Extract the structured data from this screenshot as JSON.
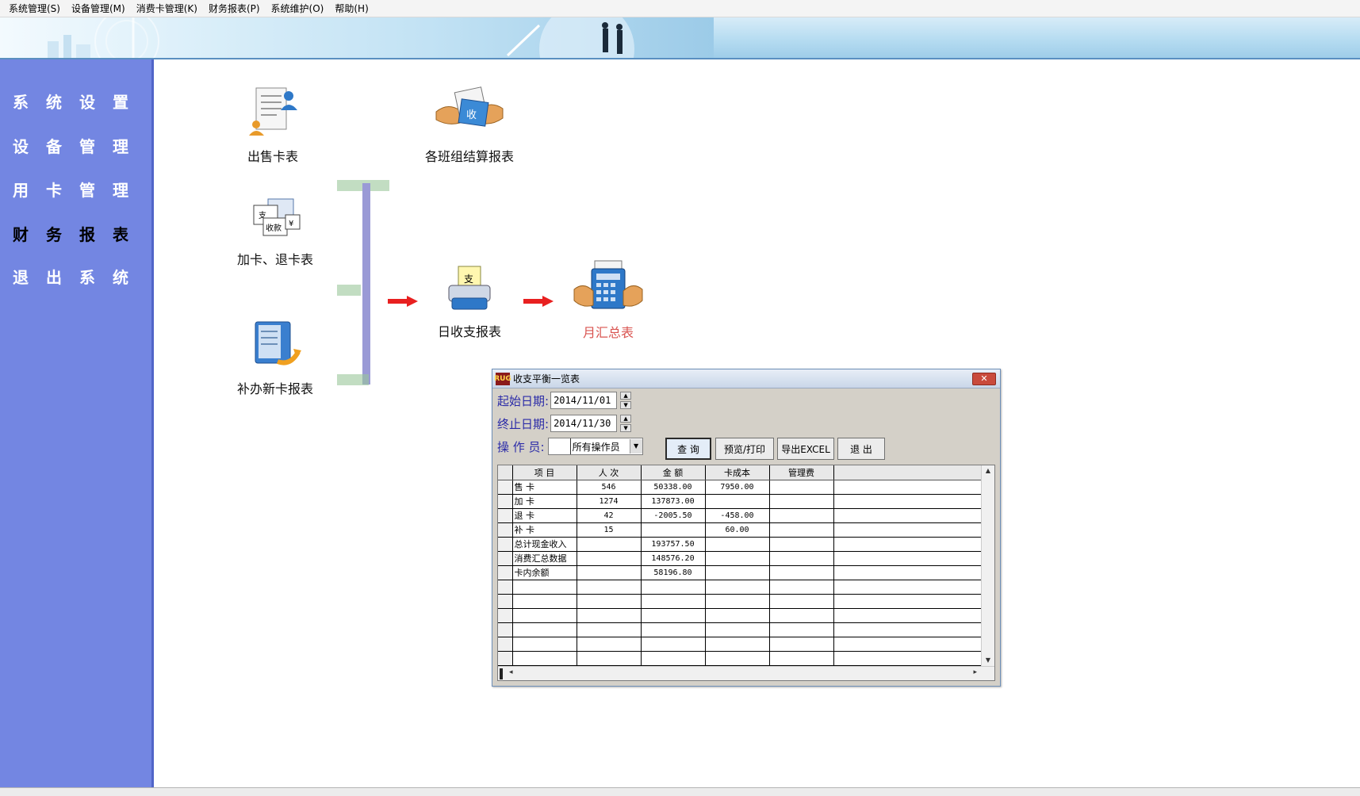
{
  "menubar": {
    "items": [
      "系统管理(S)",
      "设备管理(M)",
      "消费卡管理(K)",
      "财务报表(P)",
      "系统维护(O)",
      "帮助(H)"
    ]
  },
  "sidebar": {
    "items": [
      {
        "label": "系统设置",
        "active": false
      },
      {
        "label": "设备管理",
        "active": false
      },
      {
        "label": "用卡管理",
        "active": false
      },
      {
        "label": "财务报表",
        "active": true
      },
      {
        "label": "退出系统",
        "active": false
      }
    ]
  },
  "reports": {
    "sell_card": "出售卡表",
    "add_return_card": "加卡、退卡表",
    "reissue_card": "补办新卡报表",
    "shift_settlement": "各班组结算报表",
    "daily_income": "日收支报表",
    "monthly_summary": "月汇总表"
  },
  "icons": {
    "sell_card": "document-person-icon",
    "add_return_card": "receipt-cash-icon",
    "reissue_card": "card-reissue-icon",
    "shift_settlement": "handshake-receipt-icon",
    "daily_income": "printer-receipt-icon",
    "monthly_summary": "calculator-hands-icon",
    "arrow": "red-arrow-right-icon",
    "close": "close-icon"
  },
  "colors": {
    "sidebar_bg": "#7386e2",
    "connector": "#9a9ad6",
    "arrow": "#e82020",
    "form_label": "#2b2ba8",
    "monthly_label": "#d9534f"
  },
  "dialog": {
    "title": "收支平衡一览表",
    "app_icon_text": "RUG",
    "start_label": "起始日期:",
    "start_value": "2014/11/01",
    "end_label": "终止日期:",
    "end_value": "2014/11/30",
    "operator_label": "操 作 员:",
    "operator_value": "所有操作员",
    "buttons": {
      "query": "查 询",
      "preview": "预览/打印",
      "export": "导出EXCEL",
      "exit": "退 出"
    },
    "table": {
      "headers": [
        "项 目",
        "人 次",
        "金 额",
        "卡成本",
        "管理费"
      ],
      "rows": [
        [
          "售 卡",
          "546",
          "50338.00",
          "7950.00",
          ""
        ],
        [
          "加 卡",
          "1274",
          "137873.00",
          "",
          ""
        ],
        [
          "退 卡",
          "42",
          "-2005.50",
          "-458.00",
          ""
        ],
        [
          "补 卡",
          "15",
          "",
          "60.00",
          ""
        ],
        [
          "总计现金收入",
          "",
          "193757.50",
          "",
          ""
        ],
        [
          "消费汇总数据",
          "",
          "148576.20",
          "",
          ""
        ],
        [
          "卡内余额",
          "",
          "58196.80",
          "",
          ""
        ]
      ],
      "empty_rows": 7
    }
  }
}
